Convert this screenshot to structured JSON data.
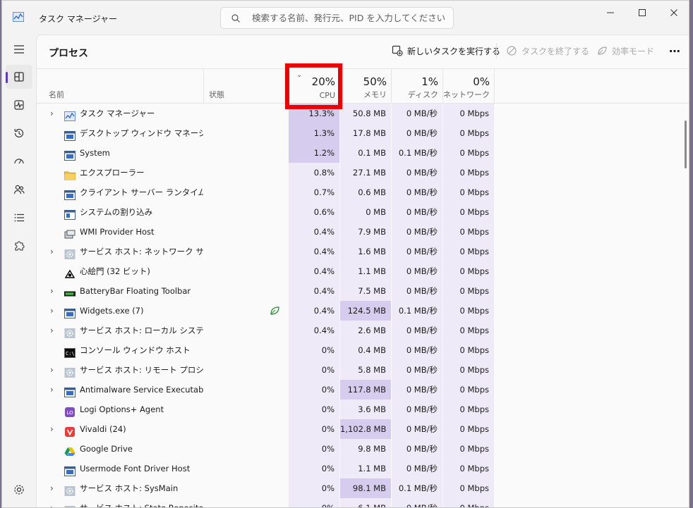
{
  "window": {
    "title": "タスク マネージャー",
    "search_placeholder": "検索する名前、発行元、PID を入力してください"
  },
  "page": {
    "title": "プロセス"
  },
  "toolbar": {
    "new_task": "新しいタスクを実行する",
    "end_task": "タスクを終了する",
    "efficiency": "効率モード",
    "more": "⋯"
  },
  "columns": {
    "name": "名前",
    "status": "状態",
    "cpu_pct": "20%",
    "cpu": "CPU",
    "mem_pct": "50%",
    "mem": "メモリ",
    "disk_pct": "1%",
    "disk": "ディスク",
    "net_pct": "0%",
    "net": "ネットワーク"
  },
  "colors": {
    "accent": "#5b3fae",
    "highlight_box": "#ee0000",
    "heat_light": "#eeeaf8",
    "heat_strong": "#d6cdee"
  },
  "processes": [
    {
      "name": "タスク マネージャー",
      "expand": true,
      "icon": "taskmgr",
      "cpu": "13.3%",
      "mem": "50.8 MB",
      "disk": "0 MB/秒",
      "net": "0 Mbps",
      "hl_cpu": true,
      "hl_mem": false
    },
    {
      "name": "デスクトップ ウィンドウ マネージャー",
      "expand": false,
      "icon": "window",
      "cpu": "1.3%",
      "mem": "17.8 MB",
      "disk": "0 MB/秒",
      "net": "0 Mbps",
      "hl_cpu": true,
      "hl_mem": false
    },
    {
      "name": "System",
      "expand": false,
      "icon": "window",
      "cpu": "1.2%",
      "mem": "0.1 MB",
      "disk": "0.1 MB/秒",
      "net": "0 Mbps",
      "hl_cpu": true,
      "hl_mem": false
    },
    {
      "name": "エクスプローラー",
      "expand": false,
      "icon": "folder",
      "cpu": "0.8%",
      "mem": "27.1 MB",
      "disk": "0 MB/秒",
      "net": "0 Mbps",
      "hl_cpu": false,
      "hl_mem": false
    },
    {
      "name": "クライアント サーバー ランタイム プロ...",
      "expand": false,
      "icon": "window",
      "cpu": "0.7%",
      "mem": "0.6 MB",
      "disk": "0 MB/秒",
      "net": "0 Mbps",
      "hl_cpu": false,
      "hl_mem": false
    },
    {
      "name": "システムの割り込み",
      "expand": false,
      "icon": "window2",
      "cpu": "0.6%",
      "mem": "0 MB",
      "disk": "0 MB/秒",
      "net": "0 Mbps",
      "hl_cpu": false,
      "hl_mem": false
    },
    {
      "name": "WMI Provider Host",
      "expand": false,
      "icon": "wmi",
      "cpu": "0.4%",
      "mem": "7.9 MB",
      "disk": "0 MB/秒",
      "net": "0 Mbps",
      "hl_cpu": false,
      "hl_mem": false
    },
    {
      "name": "サービス ホスト: ネットワーク サービス",
      "expand": true,
      "icon": "gear",
      "cpu": "0.4%",
      "mem": "1.6 MB",
      "disk": "0 MB/秒",
      "net": "0 Mbps",
      "hl_cpu": false,
      "hl_mem": false
    },
    {
      "name": "心絵門 (32 ビット)",
      "expand": false,
      "icon": "kokoro",
      "cpu": "0.4%",
      "mem": "1.1 MB",
      "disk": "0 MB/秒",
      "net": "0 Mbps",
      "hl_cpu": false,
      "hl_mem": false
    },
    {
      "name": "BatteryBar Floating Toolbar",
      "expand": true,
      "icon": "battery",
      "cpu": "0.4%",
      "mem": "7.5 MB",
      "disk": "0 MB/秒",
      "net": "0 Mbps",
      "hl_cpu": false,
      "hl_mem": false
    },
    {
      "name": "Widgets.exe (7)",
      "expand": true,
      "icon": "window",
      "cpu": "0.4%",
      "mem": "124.5 MB",
      "disk": "0.1 MB/秒",
      "net": "0 Mbps",
      "hl_cpu": false,
      "hl_mem": true,
      "leaf": true
    },
    {
      "name": "サービス ホスト: ローカル システム (...",
      "expand": true,
      "icon": "gear",
      "cpu": "0.4%",
      "mem": "2.6 MB",
      "disk": "0 MB/秒",
      "net": "0 Mbps",
      "hl_cpu": false,
      "hl_mem": false
    },
    {
      "name": "コンソール ウィンドウ ホスト",
      "expand": false,
      "icon": "console",
      "cpu": "0%",
      "mem": "0.4 MB",
      "disk": "0 MB/秒",
      "net": "0 Mbps",
      "hl_cpu": false,
      "hl_mem": false
    },
    {
      "name": "サービス ホスト: リモート プロシージ...",
      "expand": true,
      "icon": "gear",
      "cpu": "0%",
      "mem": "5.8 MB",
      "disk": "0 MB/秒",
      "net": "0 Mbps",
      "hl_cpu": false,
      "hl_mem": false
    },
    {
      "name": "Antimalware Service Executable",
      "expand": true,
      "icon": "window",
      "cpu": "0%",
      "mem": "117.8 MB",
      "disk": "0 MB/秒",
      "net": "0 Mbps",
      "hl_cpu": false,
      "hl_mem": true
    },
    {
      "name": "Logi Options+ Agent",
      "expand": false,
      "icon": "logi",
      "cpu": "0%",
      "mem": "3.6 MB",
      "disk": "0 MB/秒",
      "net": "0 Mbps",
      "hl_cpu": false,
      "hl_mem": false
    },
    {
      "name": "Vivaldi (24)",
      "expand": true,
      "icon": "vivaldi",
      "cpu": "0%",
      "mem": "1,102.8 MB",
      "disk": "0 MB/秒",
      "net": "0 Mbps",
      "hl_cpu": false,
      "hl_mem": true
    },
    {
      "name": "Google Drive",
      "expand": false,
      "icon": "gdrive",
      "cpu": "0%",
      "mem": "9.8 MB",
      "disk": "0 MB/秒",
      "net": "0 Mbps",
      "hl_cpu": false,
      "hl_mem": false
    },
    {
      "name": "Usermode Font Driver Host",
      "expand": false,
      "icon": "window",
      "cpu": "0%",
      "mem": "1.1 MB",
      "disk": "0 MB/秒",
      "net": "0 Mbps",
      "hl_cpu": false,
      "hl_mem": false
    },
    {
      "name": "サービス ホスト: SysMain",
      "expand": true,
      "icon": "gear",
      "cpu": "0%",
      "mem": "98.1 MB",
      "disk": "0.1 MB/秒",
      "net": "0 Mbps",
      "hl_cpu": false,
      "hl_mem": true
    },
    {
      "name": "サービス ホスト: State Repository ...",
      "expand": true,
      "icon": "gear",
      "cpu": "0%",
      "mem": "6.1 MB",
      "disk": "0 MB/秒",
      "net": "0 Mbps",
      "hl_cpu": false,
      "hl_mem": false
    }
  ]
}
